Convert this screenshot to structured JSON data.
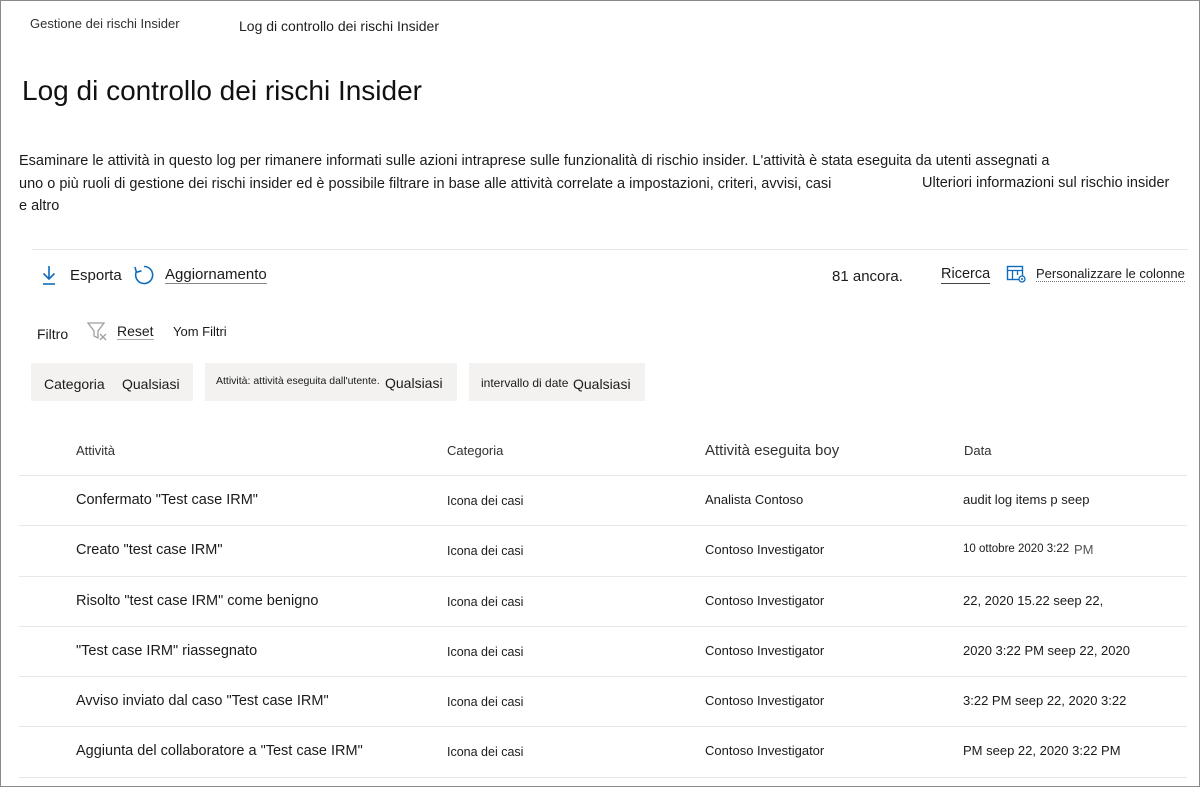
{
  "breadcrumb": {
    "root": "Gestione dei rischi Insider",
    "current": "Log di controllo dei rischi Insider"
  },
  "page_title": "Log di controllo dei rischi Insider",
  "description": {
    "line1": "Esaminare le attività in questo log per rimanere informati sulle azioni intraprese sulle funzionalità di rischio insider. L'attività è stata eseguita da utenti assegnati a",
    "line2": "uno o più ruoli di gestione dei rischi insider ed è possibile filtrare in base alle attività correlate a impostazioni, criteri, avvisi, casi",
    "line3": "e altro",
    "learn_more": "Ulteriori informazioni sul rischio insider"
  },
  "toolbar": {
    "export_label": "Esporta",
    "refresh_label": "Aggiornamento",
    "item_count": "81 ancora.",
    "search_label": "Ricerca",
    "customize_columns_label": "Personalizzare le colonne"
  },
  "filters": {
    "label": "Filtro",
    "reset_label": "Reset",
    "filters_label": "Yom Filtri",
    "chips": [
      {
        "name": "Categoria",
        "value": "Qualsiasi"
      },
      {
        "name": "Attività: attività eseguita dall'utente.",
        "value": "Qualsiasi"
      },
      {
        "name": "intervallo di date",
        "value": "Qualsiasi"
      }
    ]
  },
  "table": {
    "headers": [
      "Attività",
      "Categoria",
      "Attività eseguita boy",
      "Data"
    ],
    "rows": [
      {
        "activity": "Confermato \"Test case IRM\"",
        "category": "Icona dei casi",
        "performed_by": "Analista Contoso",
        "date": "audit log items p seep"
      },
      {
        "activity": "Creato \"test case IRM\"",
        "category": "Icona dei casi",
        "performed_by": "Contoso Investigator",
        "date": "10 ottobre 2020 3:22",
        "date_suffix": "PM"
      },
      {
        "activity": "Risolto \"test case IRM\" come benigno",
        "category": "Icona dei casi",
        "performed_by": "Contoso Investigator",
        "date": "22, 2020 15.22 seep 22,"
      },
      {
        "activity": "\"Test case IRM\" riassegnato",
        "category": "Icona dei casi",
        "performed_by": "Contoso Investigator",
        "date": "2020 3:22 PM seep 22, 2020"
      },
      {
        "activity": "Avviso inviato dal caso \"Test case IRM\"",
        "category": "Icona dei casi",
        "performed_by": "Contoso Investigator",
        "date": "3:22 PM seep 22, 2020 3:22"
      },
      {
        "activity": "Aggiunta del collaboratore a \"Test case IRM\"",
        "category": "Icona dei casi",
        "performed_by": "Contoso Investigator",
        "date": "PM seep 22, 2020 3:22 PM"
      }
    ]
  }
}
